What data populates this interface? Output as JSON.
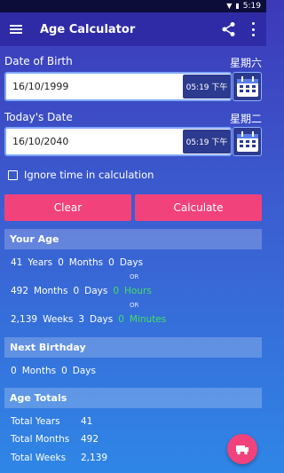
{
  "status": {
    "time": "5:19"
  },
  "app": {
    "title": "Age Calculator"
  },
  "dob": {
    "label": "Date of Birth",
    "weekday": "星期六",
    "date": "16/10/1999",
    "time": "05:19 下午"
  },
  "today": {
    "label": "Today's Date",
    "weekday": "星期二",
    "date": "16/10/2040",
    "time": "05:19 下午"
  },
  "ignore_time": {
    "label": "Ignore time in calculation",
    "checked": false
  },
  "buttons": {
    "clear": "Clear",
    "calculate": "Calculate"
  },
  "your_age": {
    "title": "Your Age",
    "years": "41",
    "years_label": "Years",
    "months": "0",
    "months_label": "Months",
    "days": "0",
    "days_label": "Days",
    "or": "OR",
    "total_months": "492",
    "total_months_label": "Months",
    "tm_days": "0",
    "tm_days_label": "Days",
    "tm_hours": "0",
    "tm_hours_label": "Hours",
    "weeks": "2,139",
    "weeks_label": "Weeks",
    "w_days": "3",
    "w_days_label": "Days",
    "w_minutes": "0",
    "w_minutes_label": "Minutes"
  },
  "next_birthday": {
    "title": "Next Birthday",
    "months": "0",
    "months_label": "Months",
    "days": "0",
    "days_label": "Days"
  },
  "age_totals": {
    "title": "Age Totals",
    "rows": [
      {
        "label": "Total Years",
        "value": "41"
      },
      {
        "label": "Total Months",
        "value": "492"
      },
      {
        "label": "Total Weeks",
        "value": "2,139"
      }
    ]
  },
  "icons": [
    "wifi-icon",
    "battery-icon",
    "menu-icon",
    "share-icon",
    "more-icon",
    "calendar-icon",
    "checkbox-icon",
    "fab-icon"
  ]
}
